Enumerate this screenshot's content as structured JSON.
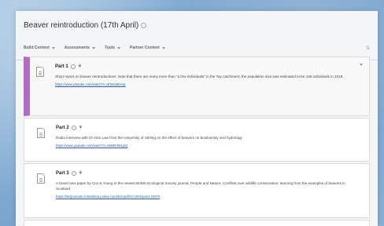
{
  "page": {
    "title": "Beaver reintroduction (17th April)"
  },
  "toolbar": {
    "items": [
      "Build Content",
      "Assessments",
      "Tools",
      "Partner Content"
    ]
  },
  "items": [
    {
      "title": "Part 1",
      "description": "Short report on beaver reintroductions. Note that there are many more than \"a few individuals\" in the Tay catchment; the population size was estimated to be 436 individuals in 2018.",
      "link": "https://www.youtube.com/watch?v=rEhebdiDcqs"
    },
    {
      "title": "Part 2",
      "description": "Radio interview with Dr Alan Law from the University of Stirling on the effect of beavers on biodiversity and hydrology",
      "link": "https://www.youtube.com/watch?v=k6MRdWLjsQ"
    },
    {
      "title": "Part 3",
      "description": "A brand new paper by Coz & Young in the newest British Ecological Society journal, People and Nature. Conflicts over wildlife conservation: learning from the examples of beavers in Scotland",
      "link": "https://besjournals.onlinelibrary.wiley.com/doi/epdf/10.1002/pan3.10075"
    }
  ]
}
